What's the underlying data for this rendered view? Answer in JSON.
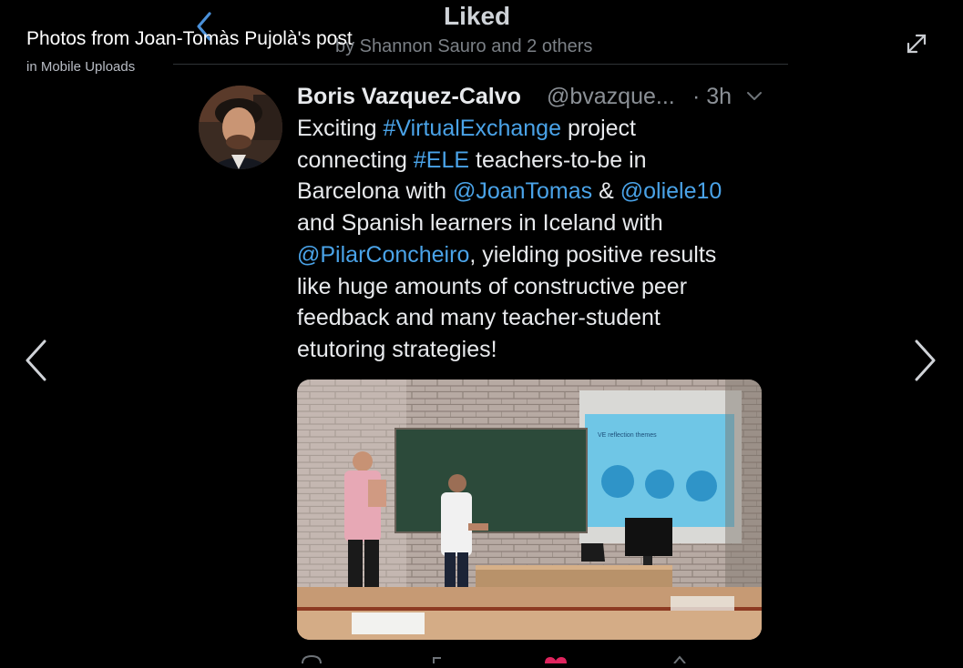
{
  "viewer": {
    "title": "Photos from Joan-Tomàs Pujolà's post",
    "subtitle": "in Mobile Uploads"
  },
  "liked_panel": {
    "title": "Liked",
    "subtitle": "by Shannon Sauro and 2 others"
  },
  "tweet": {
    "author_name": "Boris Vazquez-Calvo",
    "author_handle": "@bvazque...",
    "time": "· 3h",
    "lines": [
      [
        {
          "t": "Exciting "
        },
        {
          "t": "#VirtualExchange",
          "link": true
        },
        {
          "t": " project"
        }
      ],
      [
        {
          "t": "connecting "
        },
        {
          "t": "#ELE",
          "link": true
        },
        {
          "t": " teachers-to-be in"
        }
      ],
      [
        {
          "t": "Barcelona with "
        },
        {
          "t": "@JoanTomas",
          "link": true
        },
        {
          "t": " & "
        },
        {
          "t": "@oliele10",
          "link": true
        }
      ],
      [
        {
          "t": "and Spanish learners in Iceland with"
        }
      ],
      [
        {
          "t": "@PilarConcheiro",
          "link": true
        },
        {
          "t": ", yielding positive results"
        }
      ],
      [
        {
          "t": "like huge amounts of constructive peer"
        }
      ],
      [
        {
          "t": "feedback and many teacher-student"
        }
      ],
      [
        {
          "t": "etutoring strategies!"
        }
      ]
    ],
    "photo": {
      "slide_title": "VE reflection themes"
    }
  },
  "colors": {
    "background": "#000000",
    "link": "#4aa3e8",
    "text": "#e8eaed",
    "muted": "#8b9096"
  },
  "icons": [
    "back-chevron-icon",
    "expand-icon",
    "chevron-down-icon",
    "prev-arrow-icon",
    "next-arrow-icon"
  ]
}
